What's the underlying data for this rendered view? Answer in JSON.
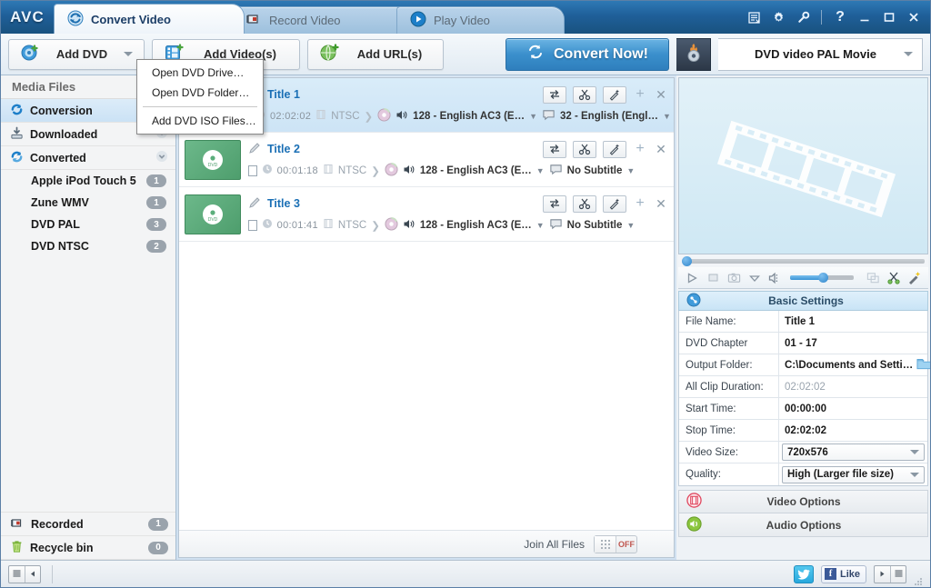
{
  "window": {
    "logo": "AVC",
    "controls": [
      {
        "name": "playlist-icon",
        "label": "▤"
      },
      {
        "name": "gear-icon",
        "label": "✿"
      },
      {
        "name": "wrench-icon",
        "label": "✎"
      },
      {
        "name": "help-icon",
        "label": "?"
      },
      {
        "name": "minimize-icon",
        "label": "—"
      },
      {
        "name": "maximize-icon",
        "label": "▭"
      },
      {
        "name": "close-icon",
        "label": "✕"
      }
    ]
  },
  "tabs": [
    {
      "label": "Convert Video",
      "icon": "convert-icon",
      "active": true
    },
    {
      "label": "Record Video",
      "icon": "record-icon",
      "active": false
    },
    {
      "label": "Play Video",
      "icon": "play-icon",
      "active": false
    }
  ],
  "toolbar": {
    "add_dvd": "Add DVD",
    "add_videos": "Add Video(s)",
    "add_urls": "Add URL(s)",
    "convert_now": "Convert Now!",
    "profile": "DVD video PAL Movie"
  },
  "dropdown_menu": {
    "items": [
      {
        "label": "Open DVD Drive…",
        "separator_after": false
      },
      {
        "label": "Open DVD Folder…",
        "separator_after": true
      },
      {
        "label": "Add DVD ISO Files…",
        "separator_after": false
      }
    ]
  },
  "sidebar": {
    "header": "Media Files",
    "rows": [
      {
        "label": "Conversion",
        "icon": "conversion-icon",
        "selected": true,
        "expand": false
      },
      {
        "label": "Downloaded",
        "icon": "downloaded-icon",
        "selected": false,
        "expand": true
      },
      {
        "label": "Converted",
        "icon": "converted-icon",
        "selected": false,
        "expand": true
      }
    ],
    "sub_items": [
      {
        "label": "Apple iPod Touch 5",
        "count": "1"
      },
      {
        "label": "Zune WMV",
        "count": "1"
      },
      {
        "label": "DVD PAL",
        "count": "3"
      },
      {
        "label": "DVD NTSC",
        "count": "2"
      }
    ],
    "bottom_rows": [
      {
        "label": "Recorded",
        "icon": "recorded-icon",
        "count": "1"
      },
      {
        "label": "Recycle bin",
        "icon": "trash-icon",
        "count": "0"
      }
    ]
  },
  "filelist": {
    "rows": [
      {
        "title": "Title 1",
        "duration": "02:02:02",
        "format": "NTSC",
        "audio": "128 - English AC3 (E…",
        "subtitle": "32 - English (Engl…",
        "selected": true
      },
      {
        "title": "Title 2",
        "duration": "00:01:18",
        "format": "NTSC",
        "audio": "128 - English AC3 (E…",
        "subtitle": "No Subtitle",
        "selected": false
      },
      {
        "title": "Title 3",
        "duration": "00:01:41",
        "format": "NTSC",
        "audio": "128 - English AC3 (E…",
        "subtitle": "No Subtitle",
        "selected": false
      }
    ],
    "join_label": "Join All Files",
    "join_state": "OFF"
  },
  "right_panel": {
    "basic_settings_title": "Basic Settings",
    "settings": [
      {
        "key": "File Name:",
        "value": "Title 1",
        "type": "text"
      },
      {
        "key": "DVD Chapter",
        "value": "01 -  17",
        "type": "text"
      },
      {
        "key": "Output Folder:",
        "value": "C:\\Documents and Setti…",
        "type": "folder"
      },
      {
        "key": "All Clip Duration:",
        "value": "02:02:02",
        "type": "muted"
      },
      {
        "key": "Start Time:",
        "value": "00:00:00",
        "type": "text"
      },
      {
        "key": "Stop Time:",
        "value": "02:02:02",
        "type": "text"
      },
      {
        "key": "Video Size:",
        "value": "720x576",
        "type": "select"
      },
      {
        "key": "Quality:",
        "value": "High (Larger file size)",
        "type": "select"
      }
    ],
    "video_options": "Video Options",
    "audio_options": "Audio Options"
  },
  "statusbar": {
    "facebook_like": "Like"
  },
  "colors": {
    "accent": "#2f7fbd",
    "title_link": "#1a6fb5",
    "thumb_green": "#4e9e6d",
    "badge_gray": "#9aa3ac",
    "toggle_off": "#c0564f"
  }
}
